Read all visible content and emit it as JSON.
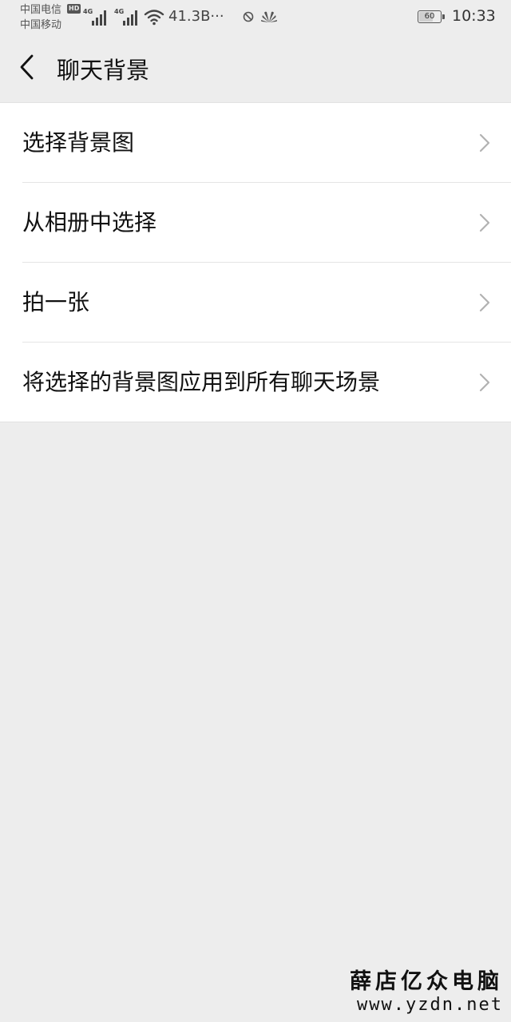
{
  "status_bar": {
    "carrier_1": "中国电信",
    "carrier_2": "中国移动",
    "hd_badge": "HD",
    "network_1": "4G",
    "network_2": "4G",
    "net_speed": "41.3B···",
    "battery_level": "60",
    "time": "10:33"
  },
  "header": {
    "title": "聊天背景"
  },
  "menu": {
    "items": [
      {
        "label": "选择背景图"
      },
      {
        "label": "从相册中选择"
      },
      {
        "label": "拍一张"
      },
      {
        "label": "将选择的背景图应用到所有聊天场景"
      }
    ]
  },
  "watermark": {
    "name": "薛店亿众电脑",
    "url": "www.yzdn.net"
  },
  "colors": {
    "background": "#ededed",
    "surface": "#ffffff",
    "divider": "#e5e5e5",
    "chevron": "#b2b2b2"
  }
}
